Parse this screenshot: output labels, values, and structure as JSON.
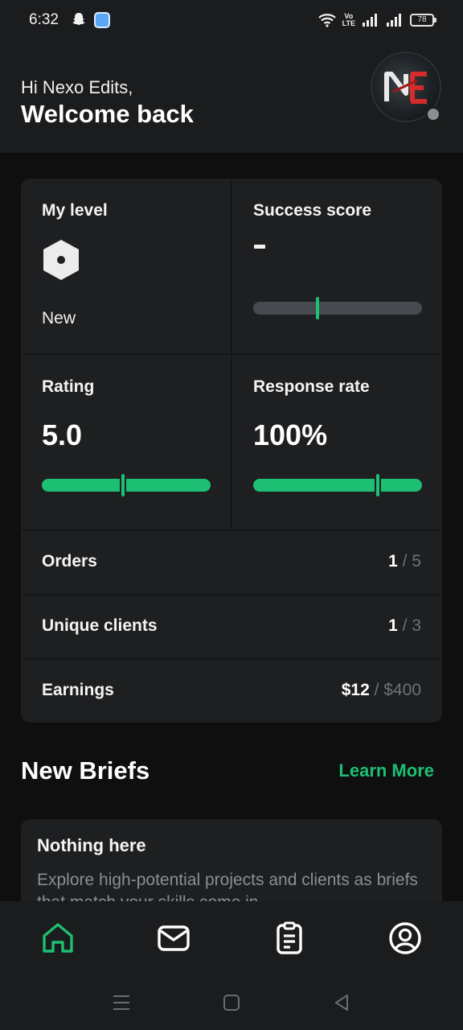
{
  "status_bar": {
    "time": "6:32",
    "network": "VoLTE",
    "battery": "78",
    "icons": [
      "snapchat-icon",
      "app-notification-icon",
      "wifi-icon",
      "volte-icon",
      "signal-icon",
      "signal-icon",
      "battery-icon"
    ]
  },
  "header": {
    "greeting": "Hi Nexo Edits,",
    "welcome": "Welcome back",
    "avatar_initials": "NE",
    "presence": "offline"
  },
  "stats": {
    "level": {
      "title": "My level",
      "value": "New"
    },
    "success": {
      "title": "Success score",
      "value": "-",
      "level": 0.38
    },
    "rating": {
      "title": "Rating",
      "value": "5.0",
      "level": 0.48
    },
    "response": {
      "title": "Response rate",
      "value": "100%",
      "level": 0.74
    },
    "rows": [
      {
        "label": "Orders",
        "current": "1",
        "separator": " / ",
        "target": "5"
      },
      {
        "label": "Unique clients",
        "current": "1",
        "separator": " / ",
        "target": "3"
      },
      {
        "label": "Earnings",
        "current": "$12",
        "separator": " / ",
        "target": "$400"
      }
    ]
  },
  "briefs": {
    "title": "New Briefs",
    "learn_more": "Learn More",
    "empty_title": "Nothing here",
    "empty_text": "Explore high-potential projects and clients as briefs that match your skills come in."
  },
  "bottom_nav": [
    {
      "name": "home",
      "icon": "home-icon",
      "active": true
    },
    {
      "name": "inbox",
      "icon": "envelope-icon",
      "active": false
    },
    {
      "name": "orders",
      "icon": "clipboard-icon",
      "active": false
    },
    {
      "name": "profile",
      "icon": "user-circle-icon",
      "active": false
    }
  ],
  "colors": {
    "accent": "#1dbf73",
    "background": "#0f0f10",
    "surface": "#1e1f21",
    "header": "#1b1c1d",
    "muted_text": "#6e7175"
  }
}
